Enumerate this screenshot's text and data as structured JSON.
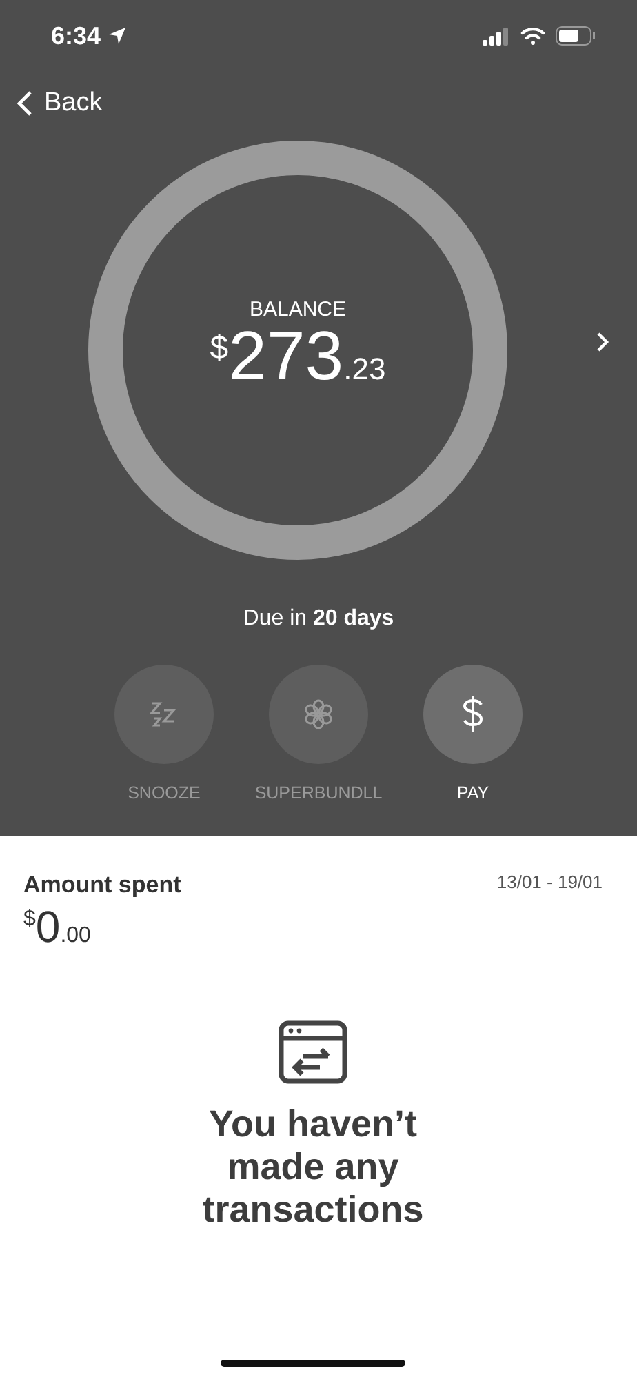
{
  "status_bar": {
    "time": "6:34"
  },
  "nav": {
    "back": "Back"
  },
  "balance": {
    "label": "BALANCE",
    "currency": "$",
    "whole": "273",
    "cents": ".23",
    "due_prefix": "Due in ",
    "due_value": "20 days"
  },
  "actions": [
    {
      "kind": "snooze",
      "label": "SNOOZE",
      "disabled": true
    },
    {
      "kind": "bundle",
      "label": "SUPERBUNDLL",
      "disabled": true
    },
    {
      "kind": "pay",
      "label": "PAY",
      "disabled": false
    }
  ],
  "spent": {
    "title": "Amount spent",
    "range": "13/01 - 19/01",
    "currency": "$",
    "whole": "0",
    "cents": ".00"
  },
  "empty": {
    "message": "You haven’t made any transactions"
  }
}
